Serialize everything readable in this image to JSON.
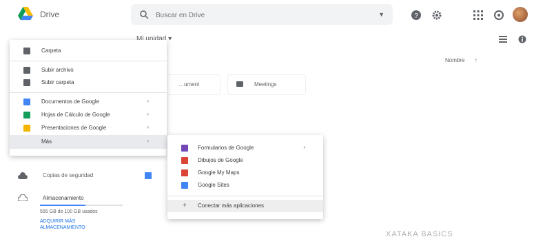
{
  "app": {
    "name": "Drive"
  },
  "search": {
    "placeholder": "Buscar en Drive"
  },
  "header": {
    "section_title": "Mi unidad ▾"
  },
  "sort": {
    "label": "Nombre",
    "arrow": "↑"
  },
  "cards": [
    {
      "label": "…ument"
    },
    {
      "label": "Meetings"
    }
  ],
  "new_menu": {
    "items": [
      {
        "label": "Carpeta",
        "color": "#5f6368"
      },
      {
        "label": "Subir archivo",
        "color": "#5f6368"
      },
      {
        "label": "Subir carpeta",
        "color": "#5f6368"
      },
      {
        "label": "Documentos de Google",
        "color": "#4285f4",
        "arrow": "›"
      },
      {
        "label": "Hojas de Cálculo de Google",
        "color": "#0f9d58",
        "arrow": "›"
      },
      {
        "label": "Presentaciones de Google",
        "color": "#f4b400",
        "arrow": "›"
      },
      {
        "label": "Más",
        "color": "",
        "arrow": "›"
      }
    ]
  },
  "more_menu": {
    "items": [
      {
        "label": "Formularios de Google",
        "color": "#7248b9",
        "arrow": "›"
      },
      {
        "label": "Dibujos de Google",
        "color": "#db4437"
      },
      {
        "label": "Google My Maps",
        "color": "#db4437"
      },
      {
        "label": "Google Sites",
        "color": "#4285f4"
      },
      {
        "label": "Conectar más aplicaciones",
        "icon": "+"
      }
    ]
  },
  "sidebar": {
    "backup_label": "Copias de seguridad",
    "storage_label": "Almacenamiento",
    "storage_used": "555 GB de 100 GB usados",
    "storage_fraction": 0.55,
    "upgrade_link": "ADQUIRIR MÁS",
    "upgrade_link2": "ALMACENAMIENTO"
  },
  "watermark": "XATAKA BASICS",
  "icons": [
    "drive-logo-icon",
    "search-icon",
    "help-icon",
    "settings-icon",
    "apps-icon",
    "notifications-icon",
    "list-view-icon",
    "info-icon",
    "cloud-icon"
  ]
}
